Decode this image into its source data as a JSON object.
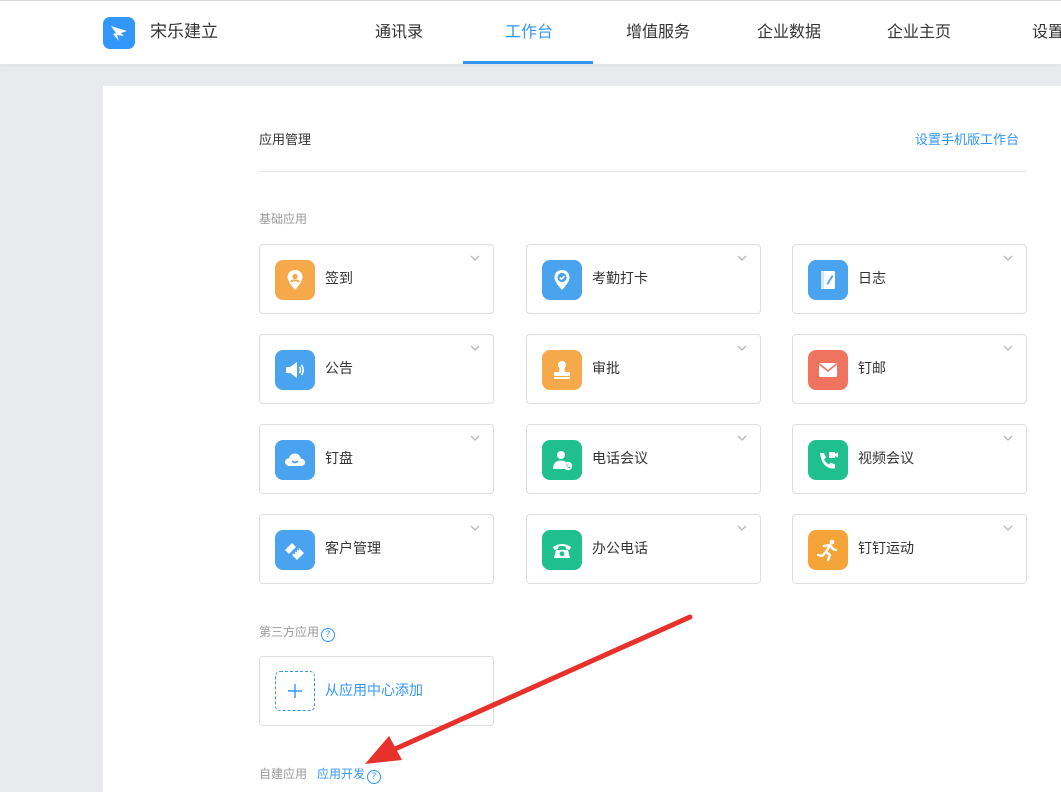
{
  "header": {
    "org_name": "宋乐建立",
    "nav": [
      {
        "label": "通讯录",
        "active": false
      },
      {
        "label": "工作台",
        "active": true
      },
      {
        "label": "增值服务",
        "active": false
      },
      {
        "label": "企业数据",
        "active": false
      },
      {
        "label": "企业主页",
        "active": false
      },
      {
        "label": "设置",
        "active": false
      }
    ]
  },
  "main": {
    "section_title": "应用管理",
    "mobile_link": "设置手机版工作台",
    "basic_label": "基础应用",
    "apps": [
      {
        "label": "签到",
        "icon": "location-pin-icon",
        "color": "#f5a94a"
      },
      {
        "label": "考勤打卡",
        "icon": "clock-pin-icon",
        "color": "#4aa3ee"
      },
      {
        "label": "日志",
        "icon": "notebook-icon",
        "color": "#4aa3ee"
      },
      {
        "label": "公告",
        "icon": "megaphone-icon",
        "color": "#4aa3ee"
      },
      {
        "label": "审批",
        "icon": "stamp-icon",
        "color": "#f5a94a"
      },
      {
        "label": "钉邮",
        "icon": "envelope-icon",
        "color": "#f07360"
      },
      {
        "label": "钉盘",
        "icon": "cloud-icon",
        "color": "#4aa3ee"
      },
      {
        "label": "电话会议",
        "icon": "person-phone-icon",
        "color": "#1fbf8f"
      },
      {
        "label": "视频会议",
        "icon": "video-phone-icon",
        "color": "#1fbf8f"
      },
      {
        "label": "客户管理",
        "icon": "handshake-icon",
        "color": "#4aa3ee"
      },
      {
        "label": "办公电话",
        "icon": "telephone-icon",
        "color": "#1fbf8f"
      },
      {
        "label": "钉钉运动",
        "icon": "runner-icon",
        "color": "#f5a43a"
      }
    ],
    "third_party_label": "第三方应用",
    "add_app_label": "从应用中心添加",
    "custom_label": "自建应用",
    "dev_link": "应用开发",
    "help_glyph": "?"
  },
  "colors": {
    "accent": "#3296fa",
    "annotation_arrow": "#e8312b"
  }
}
